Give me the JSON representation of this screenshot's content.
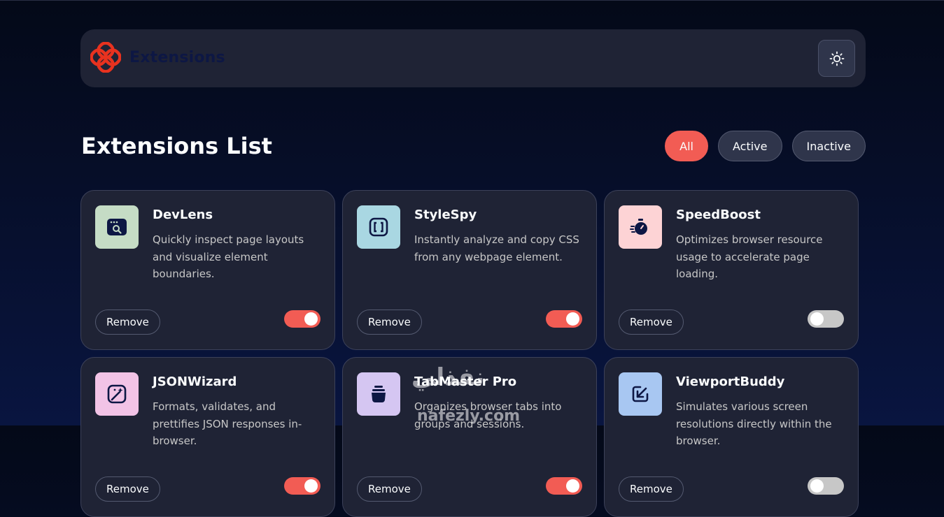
{
  "header": {
    "logo_text": "Extensions",
    "theme_icon": "sun-icon"
  },
  "main": {
    "title": "Extensions List",
    "filters": [
      {
        "label": "All",
        "active": true
      },
      {
        "label": "Active",
        "active": false
      },
      {
        "label": "Inactive",
        "active": false
      }
    ]
  },
  "extensions": [
    {
      "name": "DevLens",
      "description": "Quickly inspect page layouts and visualize element boundaries.",
      "remove_label": "Remove",
      "enabled": true,
      "icon": "inspect-window-icon",
      "icon_bg": "#c5dcc5"
    },
    {
      "name": "StyleSpy",
      "description": "Instantly analyze and copy CSS from any webpage element.",
      "remove_label": "Remove",
      "enabled": true,
      "icon": "brackets-icon",
      "icon_bg": "#a9d7e2"
    },
    {
      "name": "SpeedBoost",
      "description": "Optimizes browser resource usage to accelerate page loading.",
      "remove_label": "Remove",
      "enabled": false,
      "icon": "stopwatch-icon",
      "icon_bg": "#fdd3d5"
    },
    {
      "name": "JSONWizard",
      "description": "Formats, validates, and prettifies JSON responses in-browser.",
      "remove_label": "Remove",
      "enabled": true,
      "icon": "wand-icon",
      "icon_bg": "#f2c3e6"
    },
    {
      "name": "TabMaster Pro",
      "description": "Organizes browser tabs into groups and sessions.",
      "remove_label": "Remove",
      "enabled": true,
      "icon": "jar-icon",
      "icon_bg": "#d5c6f2"
    },
    {
      "name": "ViewportBuddy",
      "description": "Simulates various screen resolutions directly within the browser.",
      "remove_label": "Remove",
      "enabled": false,
      "icon": "resize-arrow-icon",
      "icon_bg": "#a8c7f2"
    }
  ],
  "watermark": {
    "text": "نفذلي",
    "sub": "nafezly.com"
  },
  "colors": {
    "accent": "#f25c54",
    "card_bg": "#1f2335",
    "page_bg": "#040918"
  }
}
